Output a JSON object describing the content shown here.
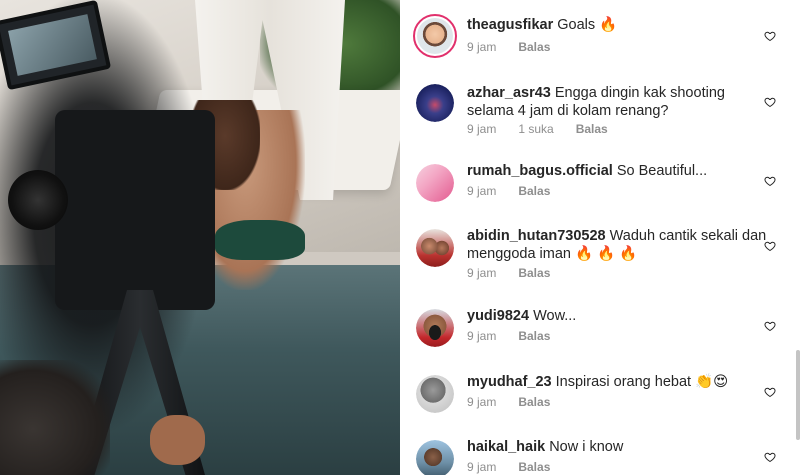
{
  "colors": {
    "text": "#262626",
    "meta": "#8e8e8e",
    "story_ring": "#e1306c"
  },
  "media": {
    "description_icon": "photo"
  },
  "comments": [
    {
      "username": "theagusfikar",
      "text": "Goals 🔥",
      "time": "9 jam",
      "likes": "",
      "reply": "Balas",
      "avatar": "cartoon-avatar",
      "story_ring": true
    },
    {
      "username": "azhar_asr43",
      "text": "Engga dingin kak shooting selama 4 jam di kolam renang?",
      "time": "9 jam",
      "likes": "1 suka",
      "reply": "Balas",
      "avatar": "blue-night-avatar",
      "story_ring": false
    },
    {
      "username": "rumah_bagus.official",
      "text": "So Beautiful...",
      "time": "9 jam",
      "likes": "",
      "reply": "Balas",
      "avatar": "pink-card-avatar",
      "story_ring": false
    },
    {
      "username": "abidin_hutan730528",
      "text": "Waduh cantik sekali dan menggoda iman 🔥 🔥 🔥",
      "time": "9 jam",
      "likes": "",
      "reply": "Balas",
      "avatar": "group-photo-avatar",
      "story_ring": false
    },
    {
      "username": "yudi9824",
      "text": "Wow...",
      "time": "9 jam",
      "likes": "",
      "reply": "Balas",
      "avatar": "masked-man-avatar",
      "story_ring": false
    },
    {
      "username": "myudhaf_23",
      "text": "Inspirasi orang hebat 👏😍",
      "time": "9 jam",
      "likes": "",
      "reply": "Balas",
      "avatar": "grey-photo-avatar",
      "story_ring": false
    },
    {
      "username": "haikal_haik",
      "text": "Now i know",
      "time": "9 jam",
      "likes": "",
      "reply": "Balas",
      "avatar": "outdoor-photo-avatar",
      "story_ring": false
    }
  ]
}
